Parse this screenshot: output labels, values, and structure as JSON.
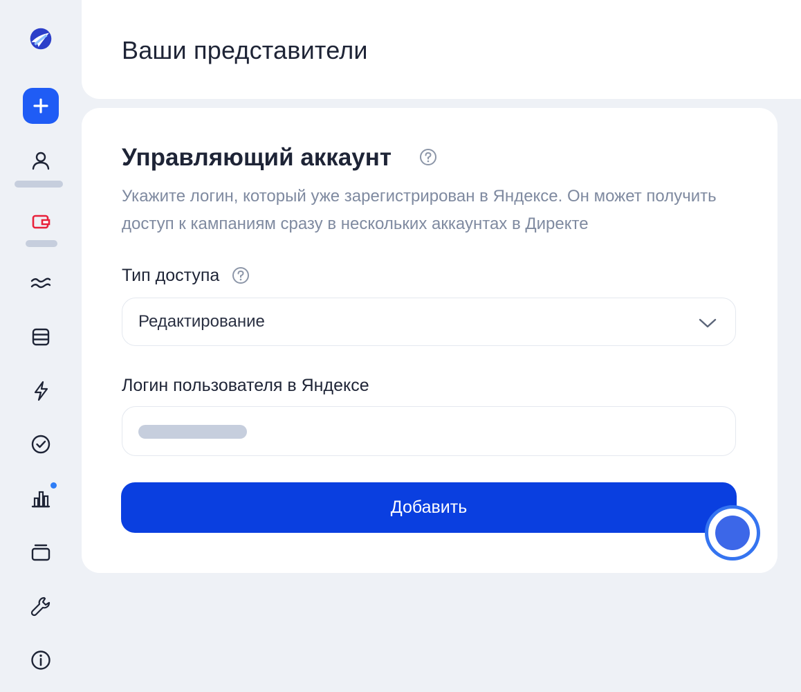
{
  "header": {
    "title": "Ваши представители"
  },
  "sidebar": {
    "items": [
      {
        "icon": "logo-icon"
      },
      {
        "icon": "plus-icon"
      },
      {
        "icon": "user-icon"
      },
      {
        "icon": "wallet-icon"
      },
      {
        "icon": "waves-icon"
      },
      {
        "icon": "list-icon"
      },
      {
        "icon": "lightning-icon"
      },
      {
        "icon": "check-circle-icon"
      },
      {
        "icon": "bar-chart-icon"
      },
      {
        "icon": "layers-icon"
      },
      {
        "icon": "wrench-icon"
      },
      {
        "icon": "info-icon"
      }
    ],
    "accent_color": "#1f5cf5",
    "active_color": "#e8203a"
  },
  "form": {
    "section_title": "Управляющий аккаунт",
    "description": "Укажите логин, который уже зарегистрирован в Яндексе. Он может получить доступ к кампаниям сразу в нескольких аккаунтах в Директе",
    "access_type_label": "Тип доступа",
    "access_type_value": "Редактирование",
    "login_label": "Логин пользователя в Яндексе",
    "submit_label": "Добавить",
    "button_color": "#0a3fe0"
  }
}
